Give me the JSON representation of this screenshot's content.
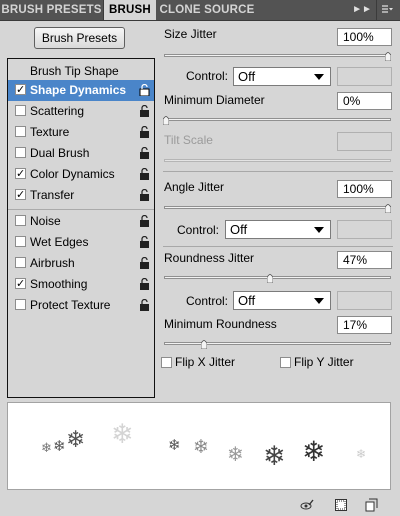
{
  "tabs": [
    {
      "label": "BRUSH PRESETS",
      "active": false
    },
    {
      "label": "BRUSH",
      "active": true
    },
    {
      "label": "CLONE SOURCE",
      "active": false
    }
  ],
  "tab_icons": {
    "collapse": "double-arrow-icon",
    "menu": "panel-menu-icon"
  },
  "presets_button": "Brush Presets",
  "list": {
    "header": "Brush Tip Shape",
    "items": [
      {
        "label": "Shape Dynamics",
        "checked": true,
        "selected": true
      },
      {
        "label": "Scattering",
        "checked": false
      },
      {
        "label": "Texture",
        "checked": false
      },
      {
        "label": "Dual Brush",
        "checked": false
      },
      {
        "label": "Color Dynamics",
        "checked": true
      },
      {
        "label": "Transfer",
        "checked": true
      },
      {
        "label": "Noise",
        "checked": false
      },
      {
        "label": "Wet Edges",
        "checked": false
      },
      {
        "label": "Airbrush",
        "checked": false
      },
      {
        "label": "Smoothing",
        "checked": true
      },
      {
        "label": "Protect Texture",
        "checked": false
      }
    ]
  },
  "controls": {
    "size_jitter": {
      "label": "Size Jitter",
      "value": "100%",
      "level": 1.0
    },
    "size_control": {
      "label": "Control:",
      "value": "Off"
    },
    "minimum_diameter": {
      "label": "Minimum Diameter",
      "value": "0%",
      "level": 0.0
    },
    "tilt_scale": {
      "label": "Tilt Scale",
      "value": ""
    },
    "angle_jitter": {
      "label": "Angle Jitter",
      "value": "100%",
      "level": 1.0
    },
    "angle_control": {
      "label": "Control:",
      "value": "Off"
    },
    "roundness_jitter": {
      "label": "Roundness Jitter",
      "value": "47%",
      "level": 0.47
    },
    "roundness_control": {
      "label": "Control:",
      "value": "Off"
    },
    "minimum_roundness": {
      "label": "Minimum Roundness",
      "value": "17%",
      "level": 0.17
    },
    "flip_x": {
      "label": "Flip X Jitter",
      "checked": false
    },
    "flip_y": {
      "label": "Flip Y Jitter",
      "checked": false
    }
  },
  "bottom_icons": [
    "toggle-live-tip-icon",
    "create-new-brush-icon",
    "new-preset-icon"
  ],
  "colors": {
    "panel_bg": "#d6d6d6",
    "tab_bar": "#535353",
    "selection": "#4a85c9"
  }
}
